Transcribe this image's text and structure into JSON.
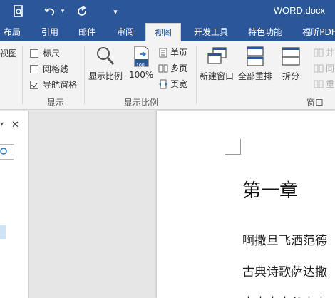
{
  "window": {
    "title": "WORD.docx"
  },
  "quick_access": {
    "qa_dropdown": "▾"
  },
  "tabs": [
    {
      "label": "布局"
    },
    {
      "label": "引用"
    },
    {
      "label": "邮件"
    },
    {
      "label": "审阅"
    },
    {
      "label": "视图",
      "active": true
    },
    {
      "label": "开发工具"
    },
    {
      "label": "特色功能"
    },
    {
      "label": "福昕PDF"
    }
  ],
  "ribbon": {
    "views_partial": "视图",
    "show_group": {
      "label": "显示",
      "ruler": {
        "label": "标尺",
        "checked": false
      },
      "gridlines": {
        "label": "网格线",
        "checked": false
      },
      "nav_pane": {
        "label": "导航窗格",
        "checked": true
      }
    },
    "zoom_group": {
      "label": "显示比例",
      "zoom": "显示比例",
      "hundred": "100%",
      "hundred_badge": "100",
      "one_page": "单页",
      "multi_page": "多页",
      "page_width": "页宽"
    },
    "window_group": {
      "label": "窗口",
      "new_window": "新建窗口",
      "arrange_all": "全部重排",
      "split": "拆分",
      "side_by_side": "并",
      "sync": "同",
      "reset": "重"
    }
  },
  "nav_pane": {
    "close": "✕",
    "menu": "▾"
  },
  "document": {
    "heading": "第一章",
    "lines": [
      "啊撒旦飞洒范德",
      "古典诗歌萨达撒",
      "大大大大分大大"
    ]
  },
  "colors": {
    "accent": "#2b579a",
    "ribbon_bg": "#f3f3f3",
    "highlight": "#cfe3f7"
  }
}
